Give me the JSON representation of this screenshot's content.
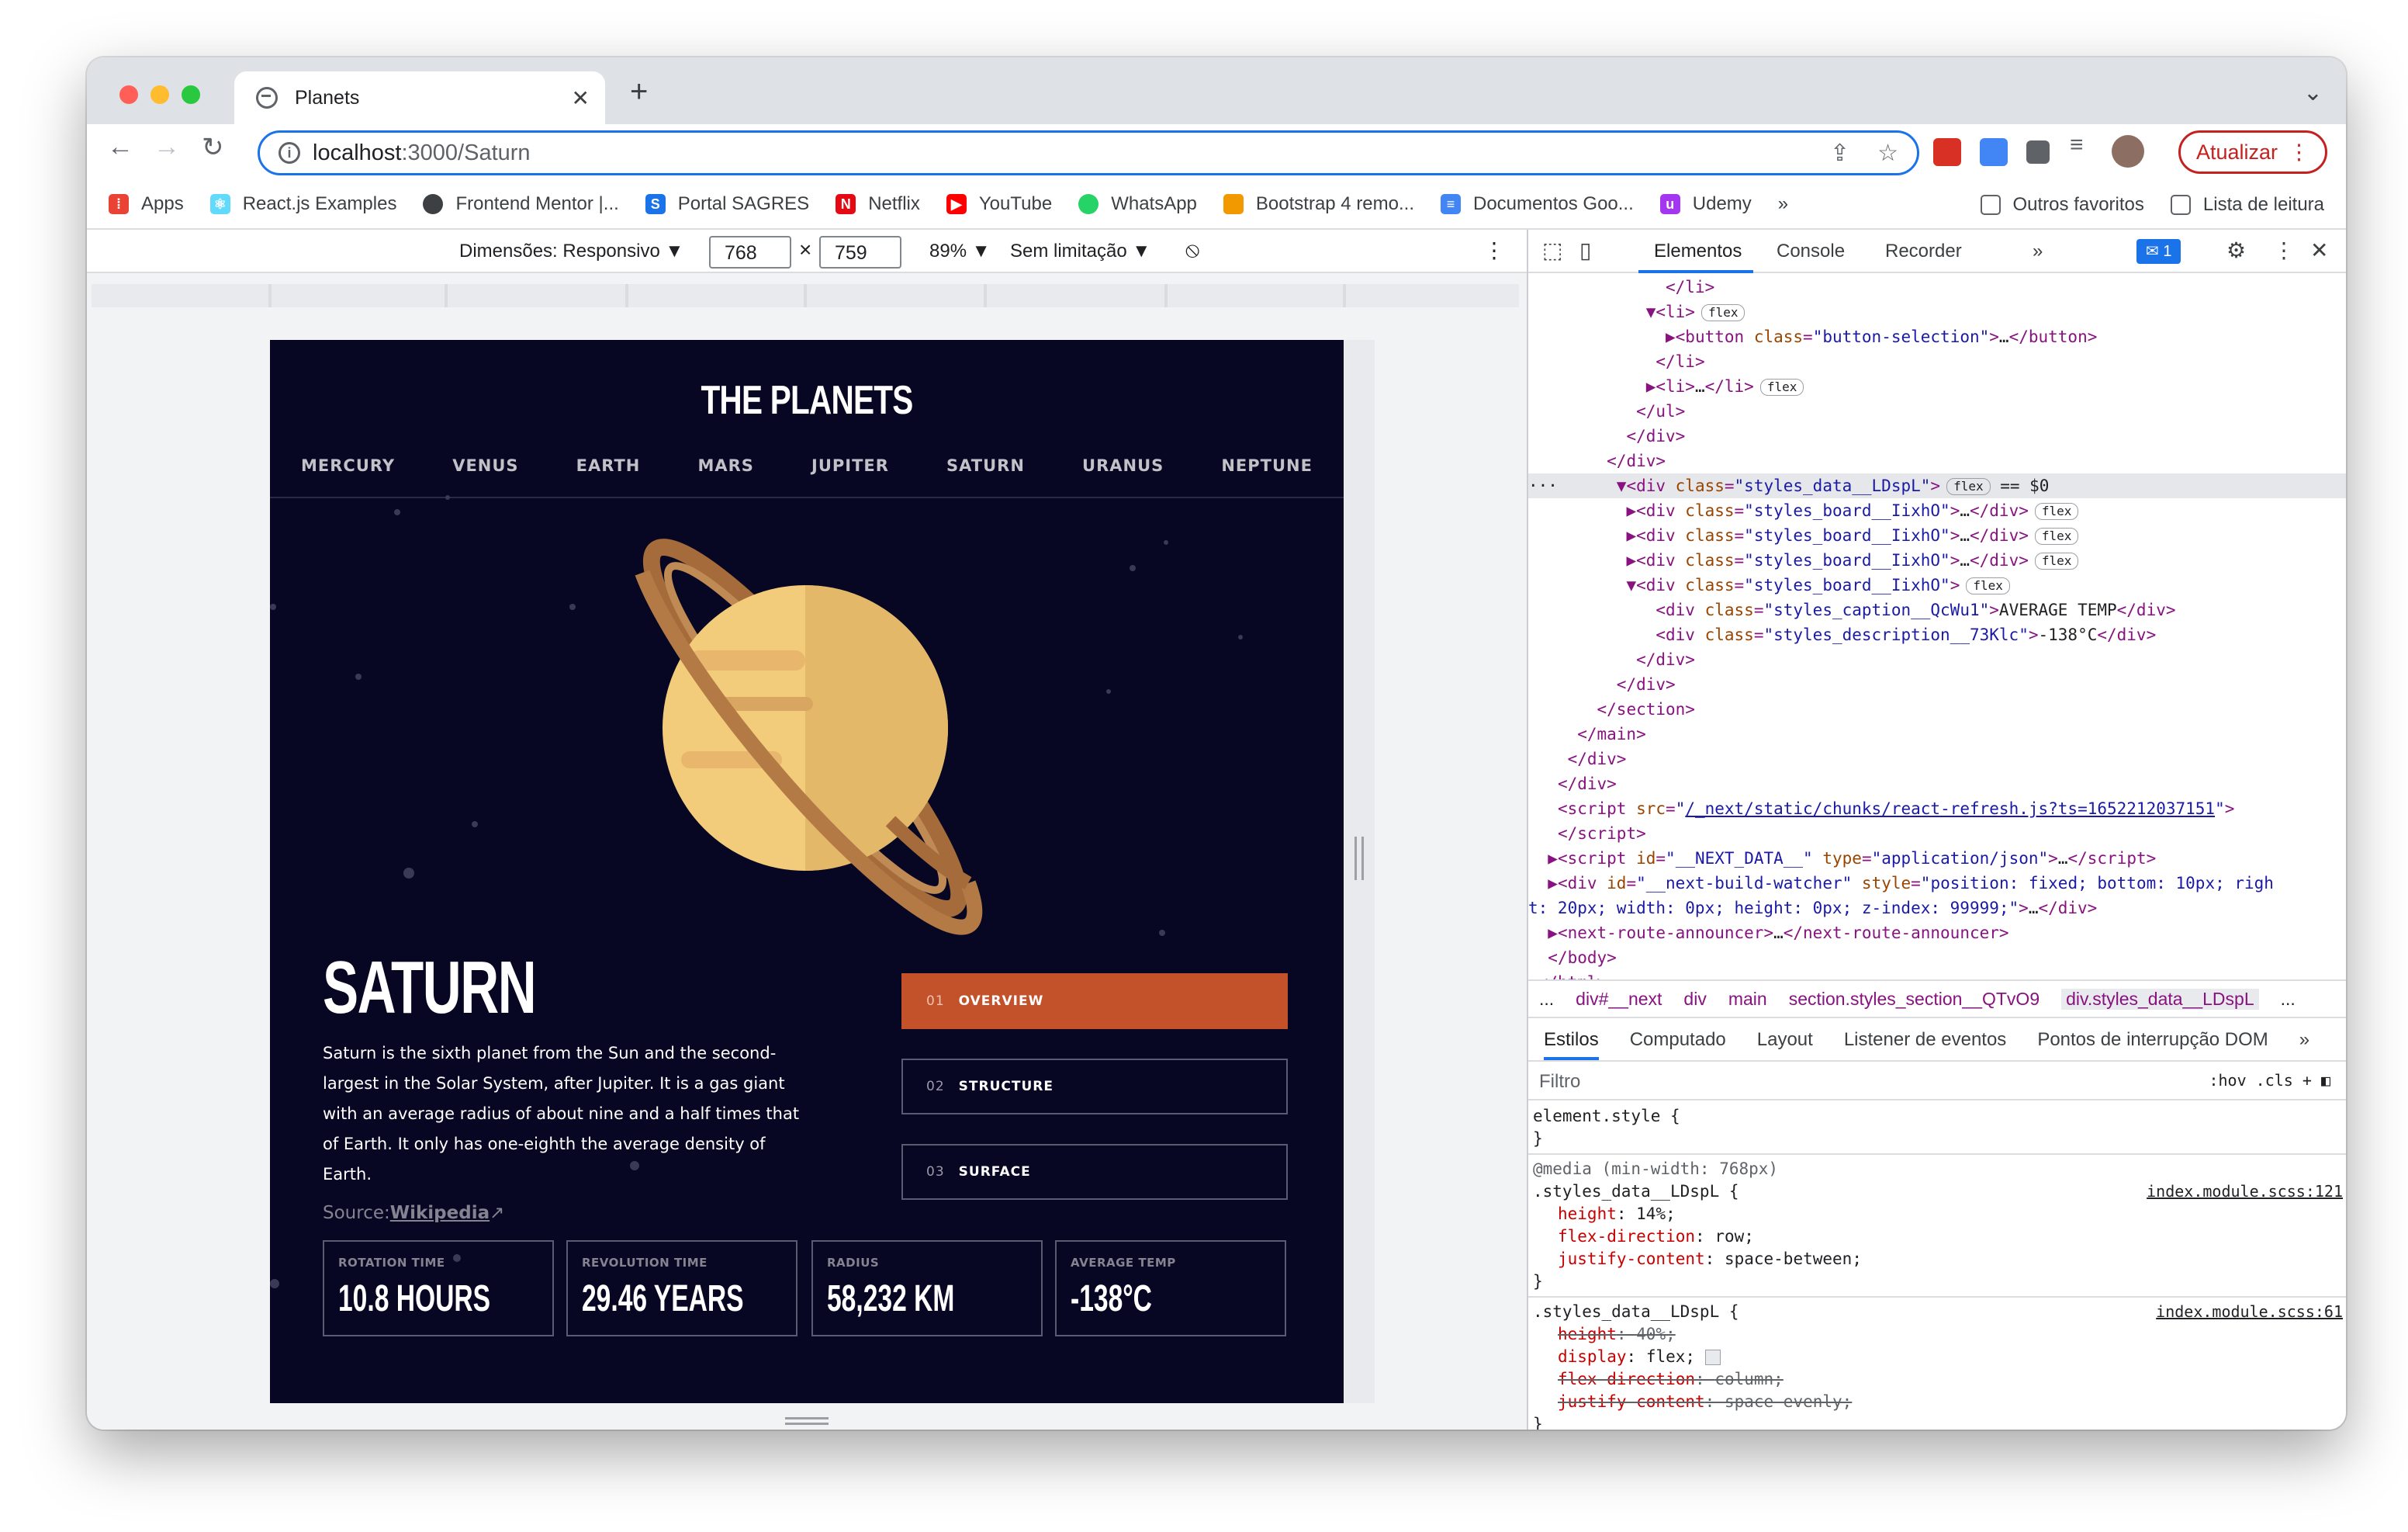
{
  "browser": {
    "tab_title": "Planets",
    "url_host": "localhost",
    "url_rest": ":3000/Saturn",
    "update_label": "Atualizar",
    "bookmarks": [
      {
        "label": "Apps",
        "color": "#ea4335"
      },
      {
        "label": "React.js Examples",
        "color": "#61dafb"
      },
      {
        "label": "Frontend Mentor |...",
        "color": "#3c4043"
      },
      {
        "label": "Portal SAGRES",
        "color": "#1a73e8"
      },
      {
        "label": "Netflix",
        "color": "#e50914"
      },
      {
        "label": "YouTube",
        "color": "#ff0000"
      },
      {
        "label": "WhatsApp",
        "color": "#25d366"
      },
      {
        "label": "Bootstrap 4 remo...",
        "color": "#f29900"
      },
      {
        "label": "Documentos Goo...",
        "color": "#4285f4"
      },
      {
        "label": "Udemy",
        "color": "#a435f0"
      }
    ],
    "bookmarks_more": "»",
    "other_favorites": "Outros favoritos",
    "reading_list": "Lista de leitura"
  },
  "device_toolbar": {
    "dimensions_label": "Dimensões: Responsivo ▼",
    "width": "768",
    "times": "×",
    "height": "759",
    "zoom": "89% ▼",
    "throttle": "Sem limitação ▼"
  },
  "planet_page": {
    "logo": "THE PLANETS",
    "nav": [
      "MERCURY",
      "VENUS",
      "EARTH",
      "MARS",
      "JUPITER",
      "SATURN",
      "URANUS",
      "NEPTUNE"
    ],
    "name": "SATURN",
    "description": "Saturn is the sixth planet from the Sun and the second-largest in the Solar System, after Jupiter. It is a gas giant with an average radius of about nine and a half times that of Earth. It only has one-eighth the average density of Earth.",
    "source_prefix": "Source:",
    "source_link": "Wikipedia",
    "buttons": [
      {
        "num": "01",
        "label": "OVERVIEW"
      },
      {
        "num": "02",
        "label": "STRUCTURE"
      },
      {
        "num": "03",
        "label": "SURFACE"
      }
    ],
    "stats": [
      {
        "caption": "ROTATION TIME",
        "value": "10.8 HOURS"
      },
      {
        "caption": "REVOLUTION TIME",
        "value": "29.46 YEARS"
      },
      {
        "caption": "RADIUS",
        "value": "58,232 KM"
      },
      {
        "caption": "AVERAGE TEMP",
        "value": "-138°C"
      }
    ],
    "accent_color": "#c3522b"
  },
  "devtools": {
    "tabs": [
      "Elementos",
      "Console",
      "Recorder",
      "»"
    ],
    "issues_count": "1",
    "breadcrumbs": [
      "...",
      "div#__next",
      "div",
      "main",
      "section.styles_section__QTvO9",
      "div.styles_data__LDspL",
      "..."
    ],
    "style_tabs": [
      "Estilos",
      "Computado",
      "Layout",
      "Listener de eventos",
      "Pontos de interrupção DOM",
      "»"
    ],
    "filter_placeholder": "Filtro",
    "filter_right": ":hov .cls + ",
    "element_style": "element.style {",
    "close_brace": "}",
    "media": "@media (min-width: 768px)",
    "rule1_selector": ".styles_data__LDspL {",
    "rule1_source": "index.module.scss:121",
    "rule1_props": [
      {
        "name": "height",
        "value": "14%;"
      },
      {
        "name": "flex-direction",
        "value": "row;"
      },
      {
        "name": "justify-content",
        "value": "space-between;"
      }
    ],
    "rule2_selector": ".styles_data__LDspL {",
    "rule2_source": "index.module.scss:61",
    "rule2_props": [
      {
        "name": "height",
        "value": "40%;",
        "struck": true
      },
      {
        "name": "display",
        "value": "flex;",
        "struck": false
      },
      {
        "name": "flex-direction",
        "value": "column;",
        "struck": true
      },
      {
        "name": "justify-content",
        "value": "space-evenly;",
        "struck": true
      }
    ]
  }
}
